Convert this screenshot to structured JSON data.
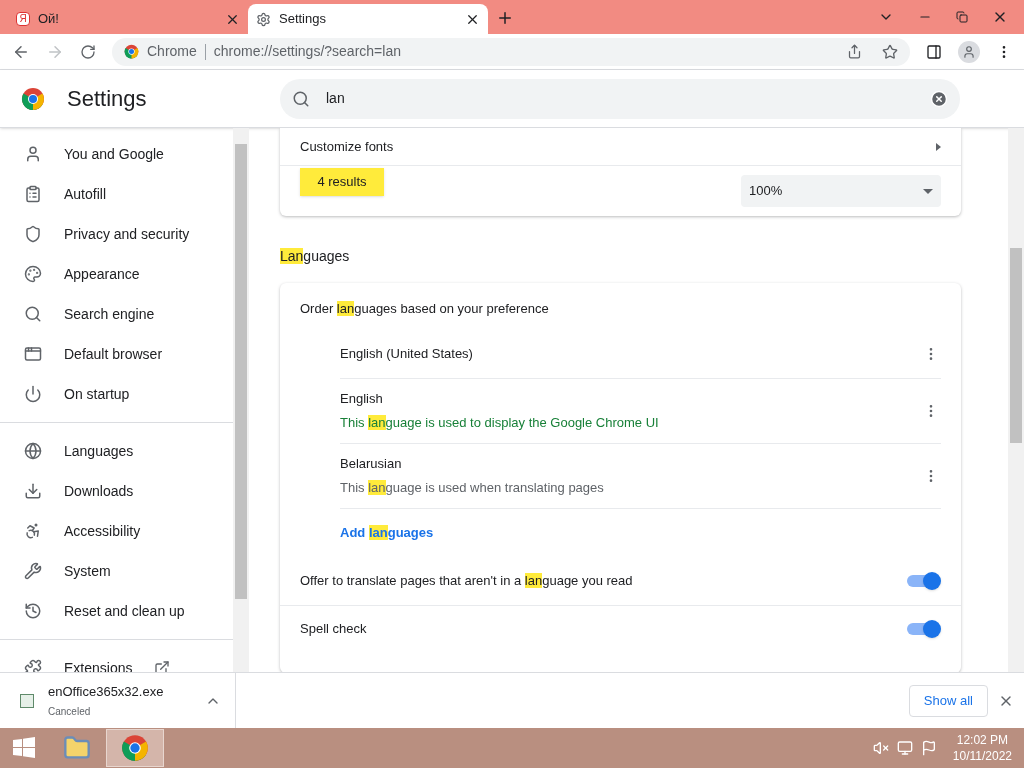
{
  "tabs": [
    {
      "title": "Ой!",
      "selected": false,
      "kind": "yandex",
      "favicon": "Я"
    },
    {
      "title": "Settings",
      "selected": true,
      "kind": "settings"
    }
  ],
  "address_bar": {
    "site": "Chrome",
    "url": "chrome://settings/?search=lan"
  },
  "header": {
    "title": "Settings",
    "search": {
      "value": "lan"
    }
  },
  "sidebar": {
    "items": [
      {
        "label": "You and Google",
        "selected": false
      },
      {
        "label": "Autofill",
        "selected": false
      },
      {
        "label": "Privacy and security",
        "selected": false
      },
      {
        "label": "Appearance",
        "selected": false
      },
      {
        "label": "Search engine",
        "selected": false
      },
      {
        "label": "Default browser",
        "selected": false
      },
      {
        "label": "On startup",
        "selected": false
      },
      {
        "label": "Languages",
        "selected": false,
        "divider_before": true
      },
      {
        "label": "Downloads",
        "selected": false
      },
      {
        "label": "Accessibility",
        "selected": false
      },
      {
        "label": "System",
        "selected": false
      },
      {
        "label": "Reset and clean up",
        "selected": false
      },
      {
        "label": "Extensions",
        "selected": false,
        "divider_before": true,
        "external": true
      }
    ]
  },
  "appearance_card": {
    "customize_fonts": "Customize fonts",
    "page_zoom_value": "100%",
    "results_tooltip": "4 results"
  },
  "languages": {
    "heading": [
      {
        "text": "Lan",
        "highlight": true
      },
      {
        "text": "guages",
        "highlight": false
      }
    ],
    "order_label": [
      {
        "text": "Order ",
        "highlight": false
      },
      {
        "text": "lan",
        "highlight": true
      },
      {
        "text": "guages based on your preference",
        "highlight": false
      }
    ],
    "list": [
      {
        "name": "English (United States)"
      },
      {
        "name": "English",
        "note": [
          {
            "text": "This ",
            "highlight": false
          },
          {
            "text": "lan",
            "highlight": true
          },
          {
            "text": "guage is used to display the Google Chrome UI",
            "highlight": false
          }
        ],
        "kind": "display"
      },
      {
        "name": "Belarusian",
        "note": [
          {
            "text": "This ",
            "highlight": false
          },
          {
            "text": "lan",
            "highlight": true
          },
          {
            "text": "guage is used when translating pages",
            "highlight": false
          }
        ],
        "kind": "translate"
      }
    ],
    "add_link": [
      {
        "text": "Add ",
        "highlight": false
      },
      {
        "text": "lan",
        "highlight": true
      },
      {
        "text": "guages",
        "highlight": false
      }
    ],
    "toggles": [
      {
        "label": [
          {
            "text": "Offer to translate pages that aren't in a ",
            "highlight": false
          },
          {
            "text": "lan",
            "highlight": true
          },
          {
            "text": "guage you read",
            "highlight": false
          }
        ],
        "on": true
      },
      {
        "label": [
          {
            "text": "Spell check",
            "highlight": false
          }
        ],
        "on": true
      }
    ]
  },
  "download_shelf": {
    "file": "enOffice365x32.exe",
    "status": "Canceled",
    "show_all": "Show all"
  },
  "taskbar": {
    "apps": [
      {
        "kind": "explorer",
        "selected": false
      },
      {
        "kind": "chrome",
        "selected": true
      }
    ],
    "time": "12:02 PM",
    "date": "10/11/2022"
  }
}
